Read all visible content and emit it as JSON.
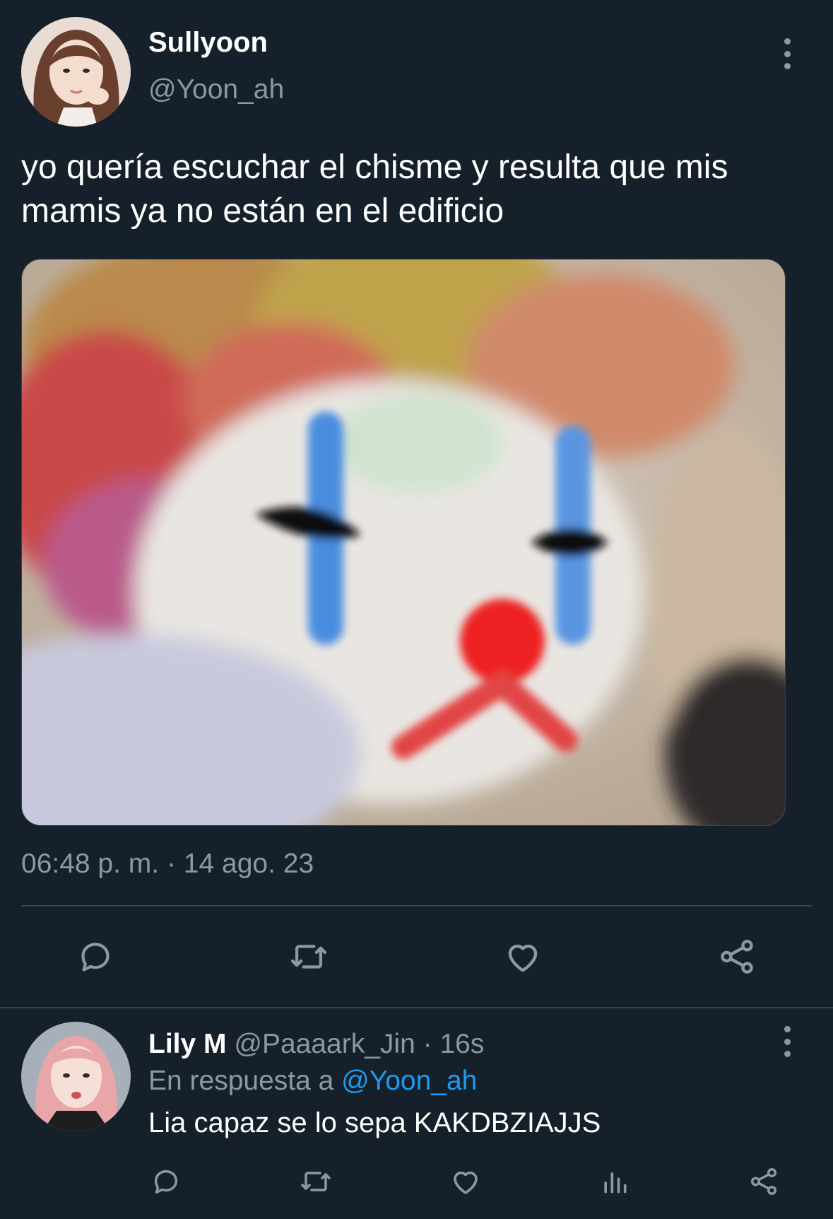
{
  "tweet": {
    "author_name": "Sullyoon",
    "author_handle": "@Yoon_ah",
    "text": "yo quería escuchar el chisme y resulta que mis mamis ya no están en el edificio",
    "time": "06:48 p. m.",
    "separator": " · ",
    "date": "14 ago. 23",
    "actions": [
      "reply-icon",
      "retweet-icon",
      "like-icon",
      "share-icon"
    ]
  },
  "reply": {
    "author_name": "Lily M",
    "author_handle": "@Paaaark_Jin",
    "separator": " · ",
    "time_ago": "16s",
    "in_reply_prefix": "En respuesta a ",
    "in_reply_to": "@Yoon_ah",
    "text": "Lia capaz se lo sepa KAKDBZIAJJS",
    "actions": [
      "reply-icon",
      "retweet-icon",
      "like-icon",
      "analytics-icon",
      "share-icon"
    ]
  },
  "colors": {
    "background": "#15202b",
    "secondary_text": "#8b98a5",
    "link": "#1d9bf0",
    "divider": "#38444d"
  }
}
